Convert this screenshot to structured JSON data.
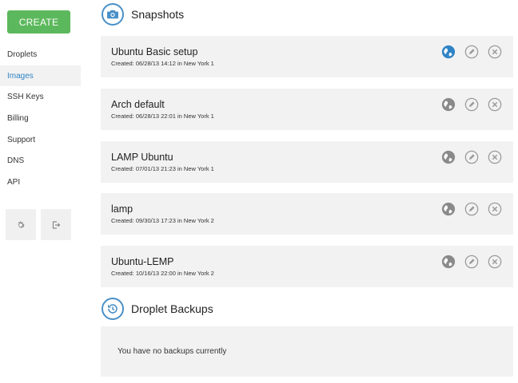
{
  "sidebar": {
    "create_label": "CREATE",
    "items": [
      {
        "label": "Droplets",
        "active": false
      },
      {
        "label": "Images",
        "active": true
      },
      {
        "label": "SSH Keys",
        "active": false
      },
      {
        "label": "Billing",
        "active": false
      },
      {
        "label": "Support",
        "active": false
      },
      {
        "label": "DNS",
        "active": false
      },
      {
        "label": "API",
        "active": false
      }
    ]
  },
  "snapshots": {
    "title": "Snapshots",
    "icon": "camera-icon",
    "items": [
      {
        "name": "Ubuntu Basic setup",
        "meta": "Created: 06/28/13 14:12 in New York 1",
        "public": true
      },
      {
        "name": "Arch default",
        "meta": "Created: 06/28/13 22:01 in New York 1",
        "public": false
      },
      {
        "name": "LAMP Ubuntu",
        "meta": "Created: 07/01/13 21:23 in New York 1",
        "public": false
      },
      {
        "name": "lamp",
        "meta": "Created: 09/30/13 17:23 in New York 2",
        "public": false
      },
      {
        "name": "Ubuntu-LEMP",
        "meta": "Created: 10/16/13 22:00 in New York 2",
        "public": false
      }
    ]
  },
  "backups": {
    "title": "Droplet Backups",
    "icon": "history-icon",
    "empty_text": "You have no backups currently"
  },
  "colors": {
    "accent": "#2f84c6",
    "create": "#5cb85c",
    "card_bg": "#f2f2f2",
    "icon_gray": "#8a8a8a"
  }
}
